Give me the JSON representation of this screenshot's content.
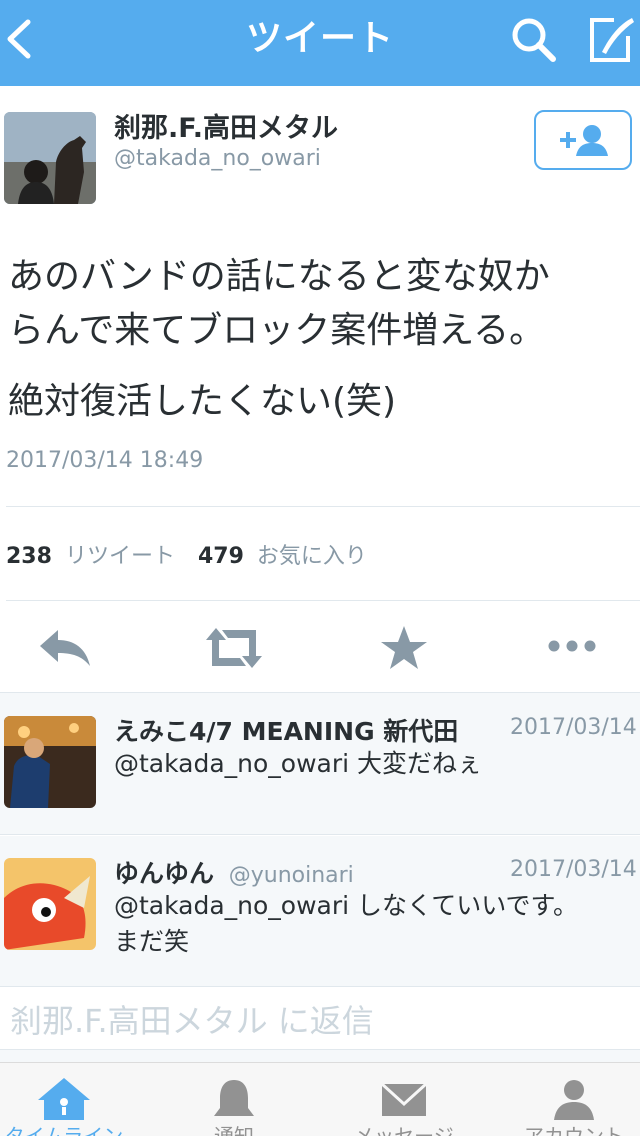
{
  "nav": {
    "title": "ツイート"
  },
  "tweet": {
    "author_name": "刹那.F.高田メタル",
    "author_handle": "@takada_no_owari",
    "text_lines": [
      "あのバンドの話になると変な奴か",
      "らんで来てブロック案件増える。"
    ],
    "text_line2": "絶対復活したくない(笑)",
    "timestamp": "2017/03/14 18:49",
    "retweet_count": "238",
    "retweet_label": "リツイート",
    "favorite_count": "479",
    "favorite_label": "お気に入り"
  },
  "replies": [
    {
      "name": "えみこ4/7 MEANING 新代田",
      "handle": "",
      "date": "2017/03/14",
      "lines": [
        "@takada_no_owari 大変だねぇ"
      ]
    },
    {
      "name": "ゆんゆん",
      "handle": "@yunoinari",
      "date": "2017/03/14",
      "lines": [
        "@takada_no_owari しなくていいです。",
        "まだ笑"
      ]
    }
  ],
  "reply_box": {
    "placeholder": "刹那.F.高田メタル に返信"
  },
  "tabs": [
    {
      "label": "タイムライン",
      "icon": "home-icon",
      "active": true
    },
    {
      "label": "通知",
      "icon": "bell-icon",
      "active": false
    },
    {
      "label": "メッセージ",
      "icon": "envelope-icon",
      "active": false
    },
    {
      "label": "アカウント",
      "icon": "person-icon",
      "active": false
    }
  ],
  "colors": {
    "brand": "#55acee",
    "icon_gray": "#8899a6",
    "text": "#292f33"
  }
}
